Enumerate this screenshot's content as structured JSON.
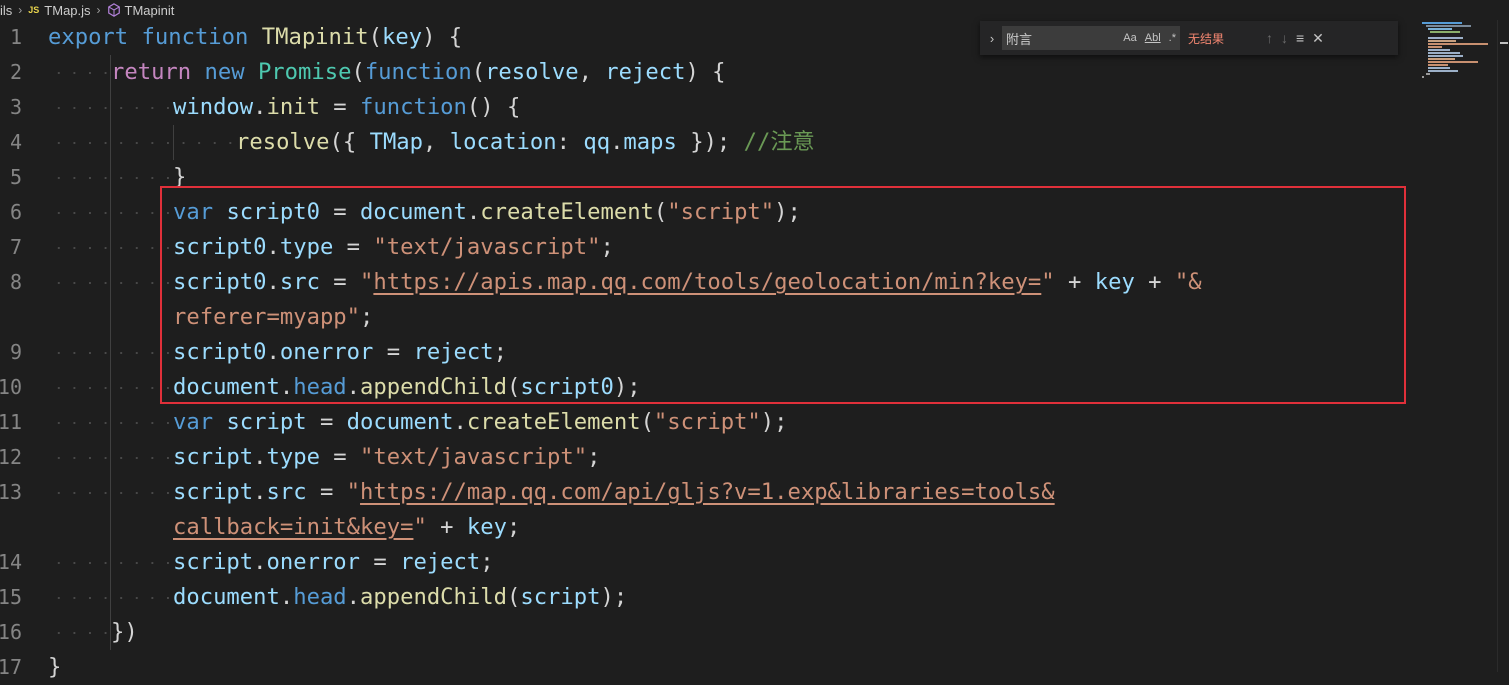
{
  "breadcrumb": {
    "items": [
      "ils",
      "TMap.js",
      "TMapinit"
    ],
    "js_badge": "JS"
  },
  "find_widget": {
    "query": "附言",
    "match_case_label": "Aa",
    "whole_word_label": "Abl",
    "regex_label": ".*",
    "status": "无结果",
    "toggle_glyph": "›",
    "prev_glyph": "↑",
    "next_glyph": "↓",
    "selection_glyph": "≡",
    "close_glyph": "✕"
  },
  "editor": {
    "line_numbers": [
      "1",
      "2",
      "3",
      "4",
      "5",
      "6",
      "7",
      "8",
      "",
      "9",
      "10",
      "11",
      "12",
      "13",
      "",
      "14",
      "15",
      "16",
      "17"
    ]
  },
  "colors": {
    "keyword": "#569cd6",
    "string": "#ce9178",
    "comment": "#6a9955",
    "highlight_border": "#e0303a",
    "no_results": "#f48771"
  },
  "icons": {
    "cube": "symbol-method-icon",
    "chevron": "chevron-right-icon"
  }
}
